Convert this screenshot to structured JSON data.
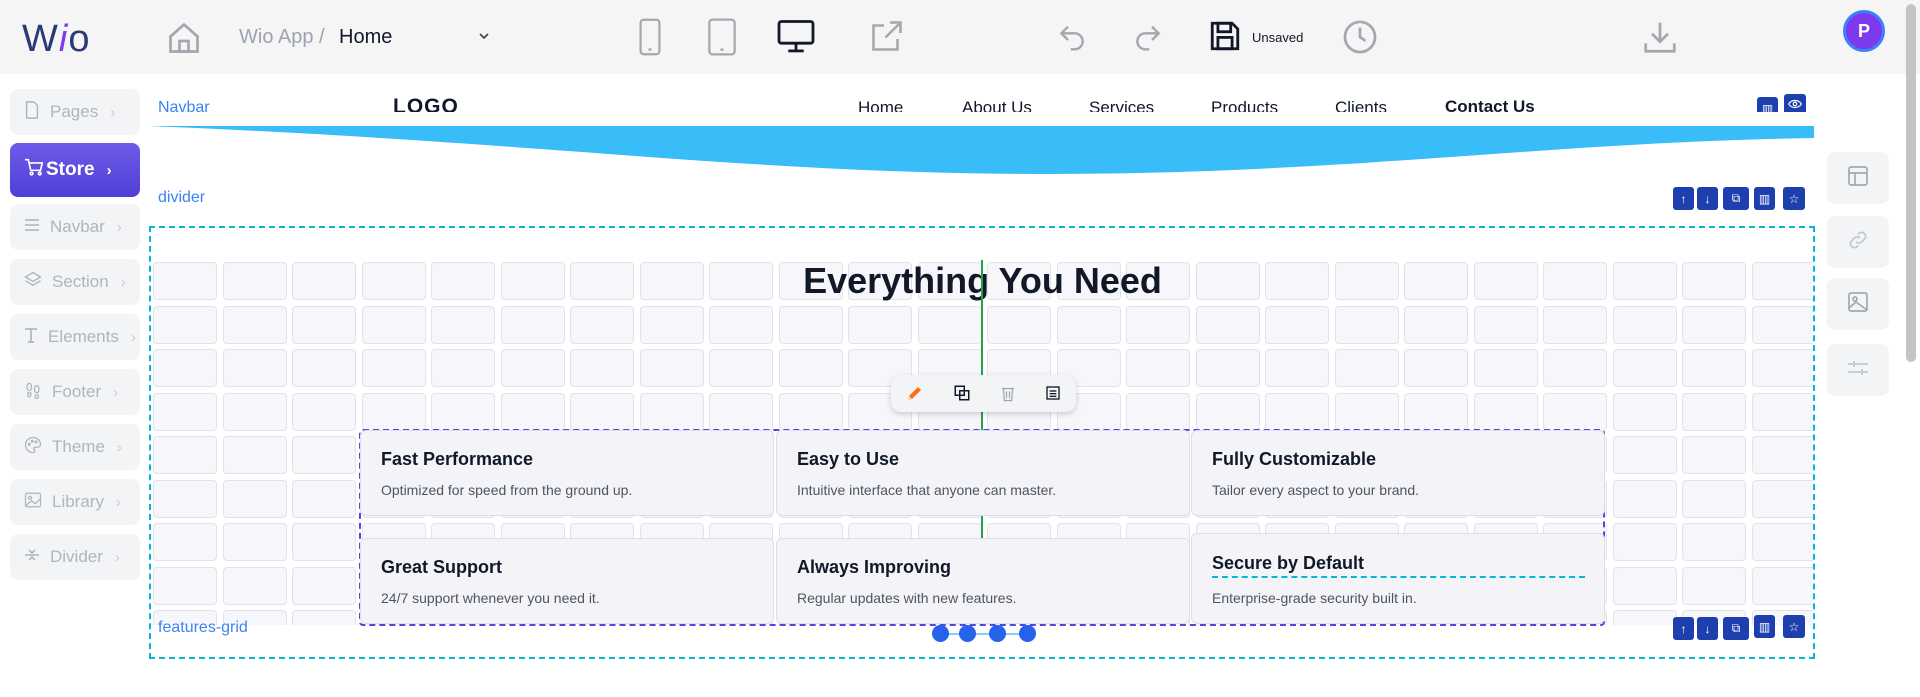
{
  "app": {
    "logo": "Wio",
    "breadcrumb": {
      "app": "Wio App",
      "separator": "/",
      "page": "Home"
    },
    "save_status": "Unsaved",
    "user_initial": "P"
  },
  "sidebar": {
    "items": [
      {
        "label": "Pages",
        "icon": "page-icon"
      },
      {
        "label": "Store",
        "icon": "cart-icon",
        "active": true
      },
      {
        "label": "Navbar",
        "icon": "menu-icon"
      },
      {
        "label": "Section",
        "icon": "layers-icon"
      },
      {
        "label": "Elements",
        "icon": "text-icon"
      },
      {
        "label": "Footer",
        "icon": "footprint-icon"
      },
      {
        "label": "Theme",
        "icon": "palette-icon"
      },
      {
        "label": "Library",
        "icon": "image-icon"
      },
      {
        "label": "Divider",
        "icon": "divider-icon"
      }
    ]
  },
  "canvas": {
    "navbar_label": "Navbar",
    "divider_label": "divider",
    "features_label": "features-grid",
    "navbar": {
      "logo": "LOGO",
      "links": [
        "Home",
        "About Us",
        "Services",
        "Products",
        "Clients",
        "Contact Us"
      ],
      "current": "Contact Us"
    },
    "headline": "Everything You Need",
    "features": [
      {
        "title": "Fast Performance",
        "desc": "Optimized for speed from the ground up."
      },
      {
        "title": "Easy to Use",
        "desc": "Intuitive interface that anyone can master."
      },
      {
        "title": "Fully Customizable",
        "desc": "Tailor every aspect to your brand."
      },
      {
        "title": "Great Support",
        "desc": "24/7 support whenever you need it."
      },
      {
        "title": "Always Improving",
        "desc": "Regular updates with new features."
      },
      {
        "title": "Secure by Default",
        "desc": "Enterprise-grade security built in."
      }
    ]
  },
  "colors": {
    "accent": "#4f3fd6",
    "wave": "#38bdf8",
    "control_blue": "#1e40af",
    "guide_green": "#22a34b",
    "selection_cyan": "#06b6d4"
  }
}
